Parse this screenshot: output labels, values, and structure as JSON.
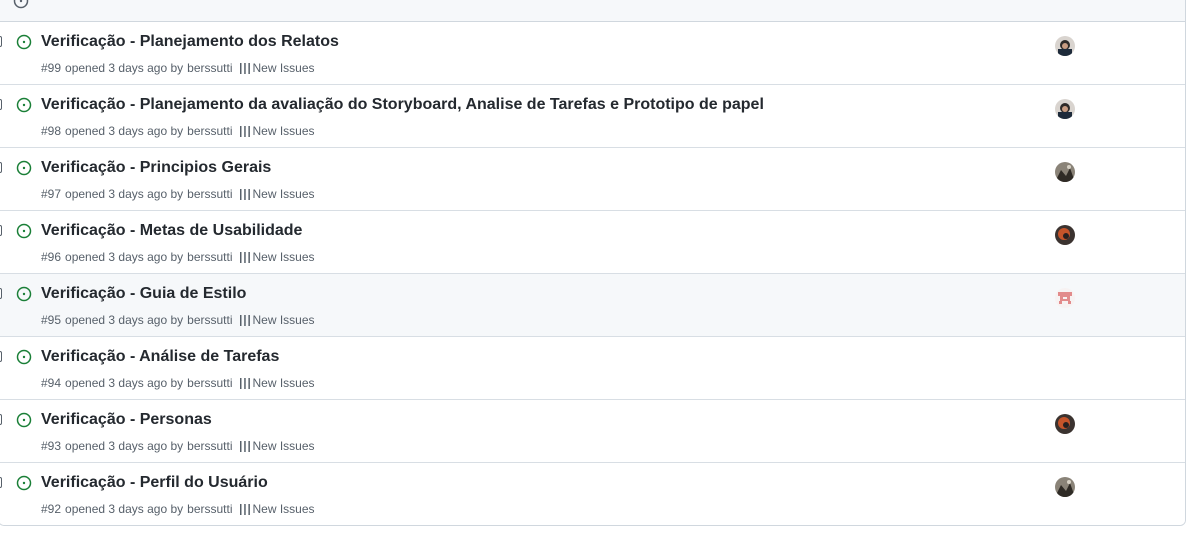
{
  "issues": [
    {
      "title": "Verificação - Planejamento dos Relatos",
      "number": "#99",
      "opened": "opened 3 days ago by",
      "author": "berssutti",
      "project": "New Issues",
      "avatar": "avatar-dark-person",
      "hovered": false
    },
    {
      "title": "Verificação - Planejamento da avaliação do Storyboard, Analise de Tarefas e Prototipo de papel",
      "number": "#98",
      "opened": "opened 3 days ago by",
      "author": "berssutti",
      "project": "New Issues",
      "avatar": "avatar-dark-person",
      "hovered": false
    },
    {
      "title": "Verificação - Principios Gerais",
      "number": "#97",
      "opened": "opened 3 days ago by",
      "author": "berssutti",
      "project": "New Issues",
      "avatar": "avatar-landscape",
      "hovered": false
    },
    {
      "title": "Verificação - Metas de Usabilidade",
      "number": "#96",
      "opened": "opened 3 days ago by",
      "author": "berssutti",
      "project": "New Issues",
      "avatar": "avatar-orange-person",
      "hovered": false
    },
    {
      "title": "Verificação - Guia de Estilo",
      "number": "#95",
      "opened": "opened 3 days ago by",
      "author": "berssutti",
      "project": "New Issues",
      "avatar": "avatar-identicon",
      "hovered": true
    },
    {
      "title": "Verificação - Análise de Tarefas",
      "number": "#94",
      "opened": "opened 3 days ago by",
      "author": "berssutti",
      "project": "New Issues",
      "avatar": "",
      "hovered": false
    },
    {
      "title": "Verificação - Personas",
      "number": "#93",
      "opened": "opened 3 days ago by",
      "author": "berssutti",
      "project": "New Issues",
      "avatar": "avatar-orange-person",
      "hovered": false
    },
    {
      "title": "Verificação - Perfil do Usuário",
      "number": "#92",
      "opened": "opened 3 days ago by",
      "author": "berssutti",
      "project": "New Issues",
      "avatar": "avatar-landscape",
      "hovered": false
    }
  ],
  "colors": {
    "open_icon": "#1a7f37",
    "title": "#24292f",
    "meta": "#57606a",
    "border": "#d0d7de",
    "hover_bg": "#f6f8fa"
  }
}
